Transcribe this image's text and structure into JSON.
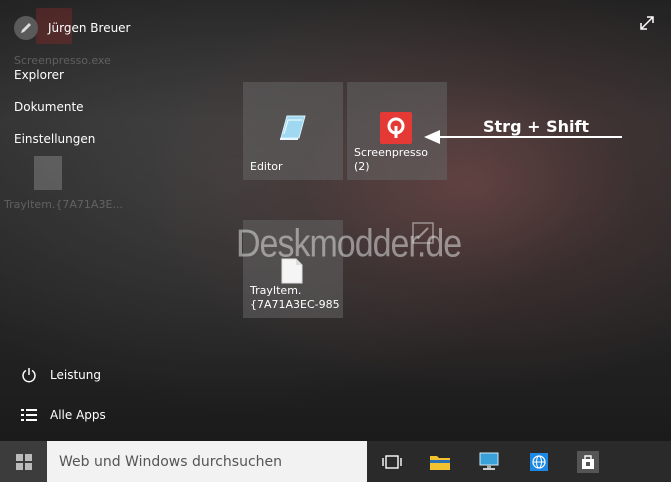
{
  "user": {
    "name": "Jürgen Breuer"
  },
  "left_menu": {
    "items": [
      {
        "label": "Explorer"
      },
      {
        "label": "Dokumente"
      },
      {
        "label": "Einstellungen"
      }
    ],
    "bottom": [
      {
        "label": "Leistung",
        "icon": "power-icon"
      },
      {
        "label": "Alle Apps",
        "icon": "list-icon"
      }
    ]
  },
  "desktop": {
    "icons": [
      {
        "label": "Screenpresso.exe",
        "icon": "screenpresso-icon"
      },
      {
        "label": "TrayItem.{7A71A3E...",
        "icon": "file-shortcut-icon"
      }
    ]
  },
  "tiles": [
    {
      "label": "Editor",
      "icon": "notepad-icon"
    },
    {
      "label": "Screenpresso\n(2)",
      "icon": "screenpresso-icon"
    },
    {
      "label": "TrayItem.\n{7A71A3EC-985",
      "icon": "document-icon"
    }
  ],
  "annotation": {
    "arrow_text": "Strg + Shift"
  },
  "watermark": {
    "text": "Deskmodder.de"
  },
  "taskbar": {
    "search_placeholder": "Web und Windows durchsuchen",
    "buttons": [
      {
        "icon": "task-view-icon"
      },
      {
        "icon": "file-explorer-icon"
      },
      {
        "icon": "network-computer-icon"
      },
      {
        "icon": "browser-globe-icon"
      },
      {
        "icon": "store-icon"
      }
    ]
  },
  "colors": {
    "screenpresso": "#e53935",
    "explorer_yellow": "#f2c230",
    "globe_blue": "#1e88e5"
  }
}
